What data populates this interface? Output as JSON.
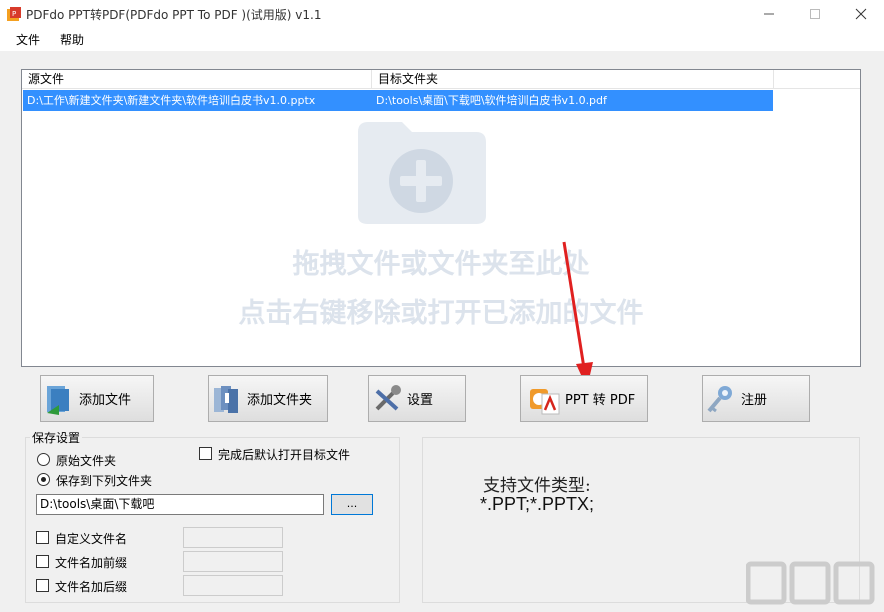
{
  "window": {
    "title": "PDFdo PPT转PDF(PDFdo PPT To PDF )(试用版) v1.1",
    "app_icon": "pdfdo-app-icon",
    "controls": [
      "minimize-icon",
      "maximize-icon",
      "close-icon"
    ]
  },
  "menu": {
    "file": "文件",
    "help": "帮助"
  },
  "file_list": {
    "columns": [
      "源文件",
      "目标文件夹"
    ],
    "rows": [
      {
        "source": "D:\\工作\\新建文件夹\\新建文件夹\\软件培训白皮书v1.0.pptx",
        "target": "D:\\tools\\桌面\\下载吧\\软件培训白皮书v1.0.pdf",
        "selected": true
      }
    ],
    "placeholder_icon": "folder-add-icon",
    "hint_line1": "拖拽文件或文件夹至此处",
    "hint_line2": "点击右键移除或打开已添加的文件"
  },
  "toolbar": {
    "add_file": "添加文件",
    "add_folder": "添加文件夹",
    "settings": "设置",
    "convert": "PPT 转 PDF",
    "register": "注册"
  },
  "save_settings": {
    "group_title": "保存设置",
    "original_folder": "原始文件夹",
    "save_to_folder": "保存到下列文件夹",
    "selected_option": "save_to_folder",
    "open_after": "完成后默认打开目标文件",
    "open_after_checked": false,
    "output_path": "D:\\tools\\桌面\\下载吧",
    "browse": "...",
    "custom_name": "自定义文件名",
    "prefix": "文件名加前缀",
    "suffix": "文件名加后缀"
  },
  "info": {
    "title": "支持文件类型:",
    "types": "*.PPT;*.PPTX;"
  },
  "colors": {
    "selection": "#3390ff",
    "annotation_arrow": "#e02020"
  }
}
